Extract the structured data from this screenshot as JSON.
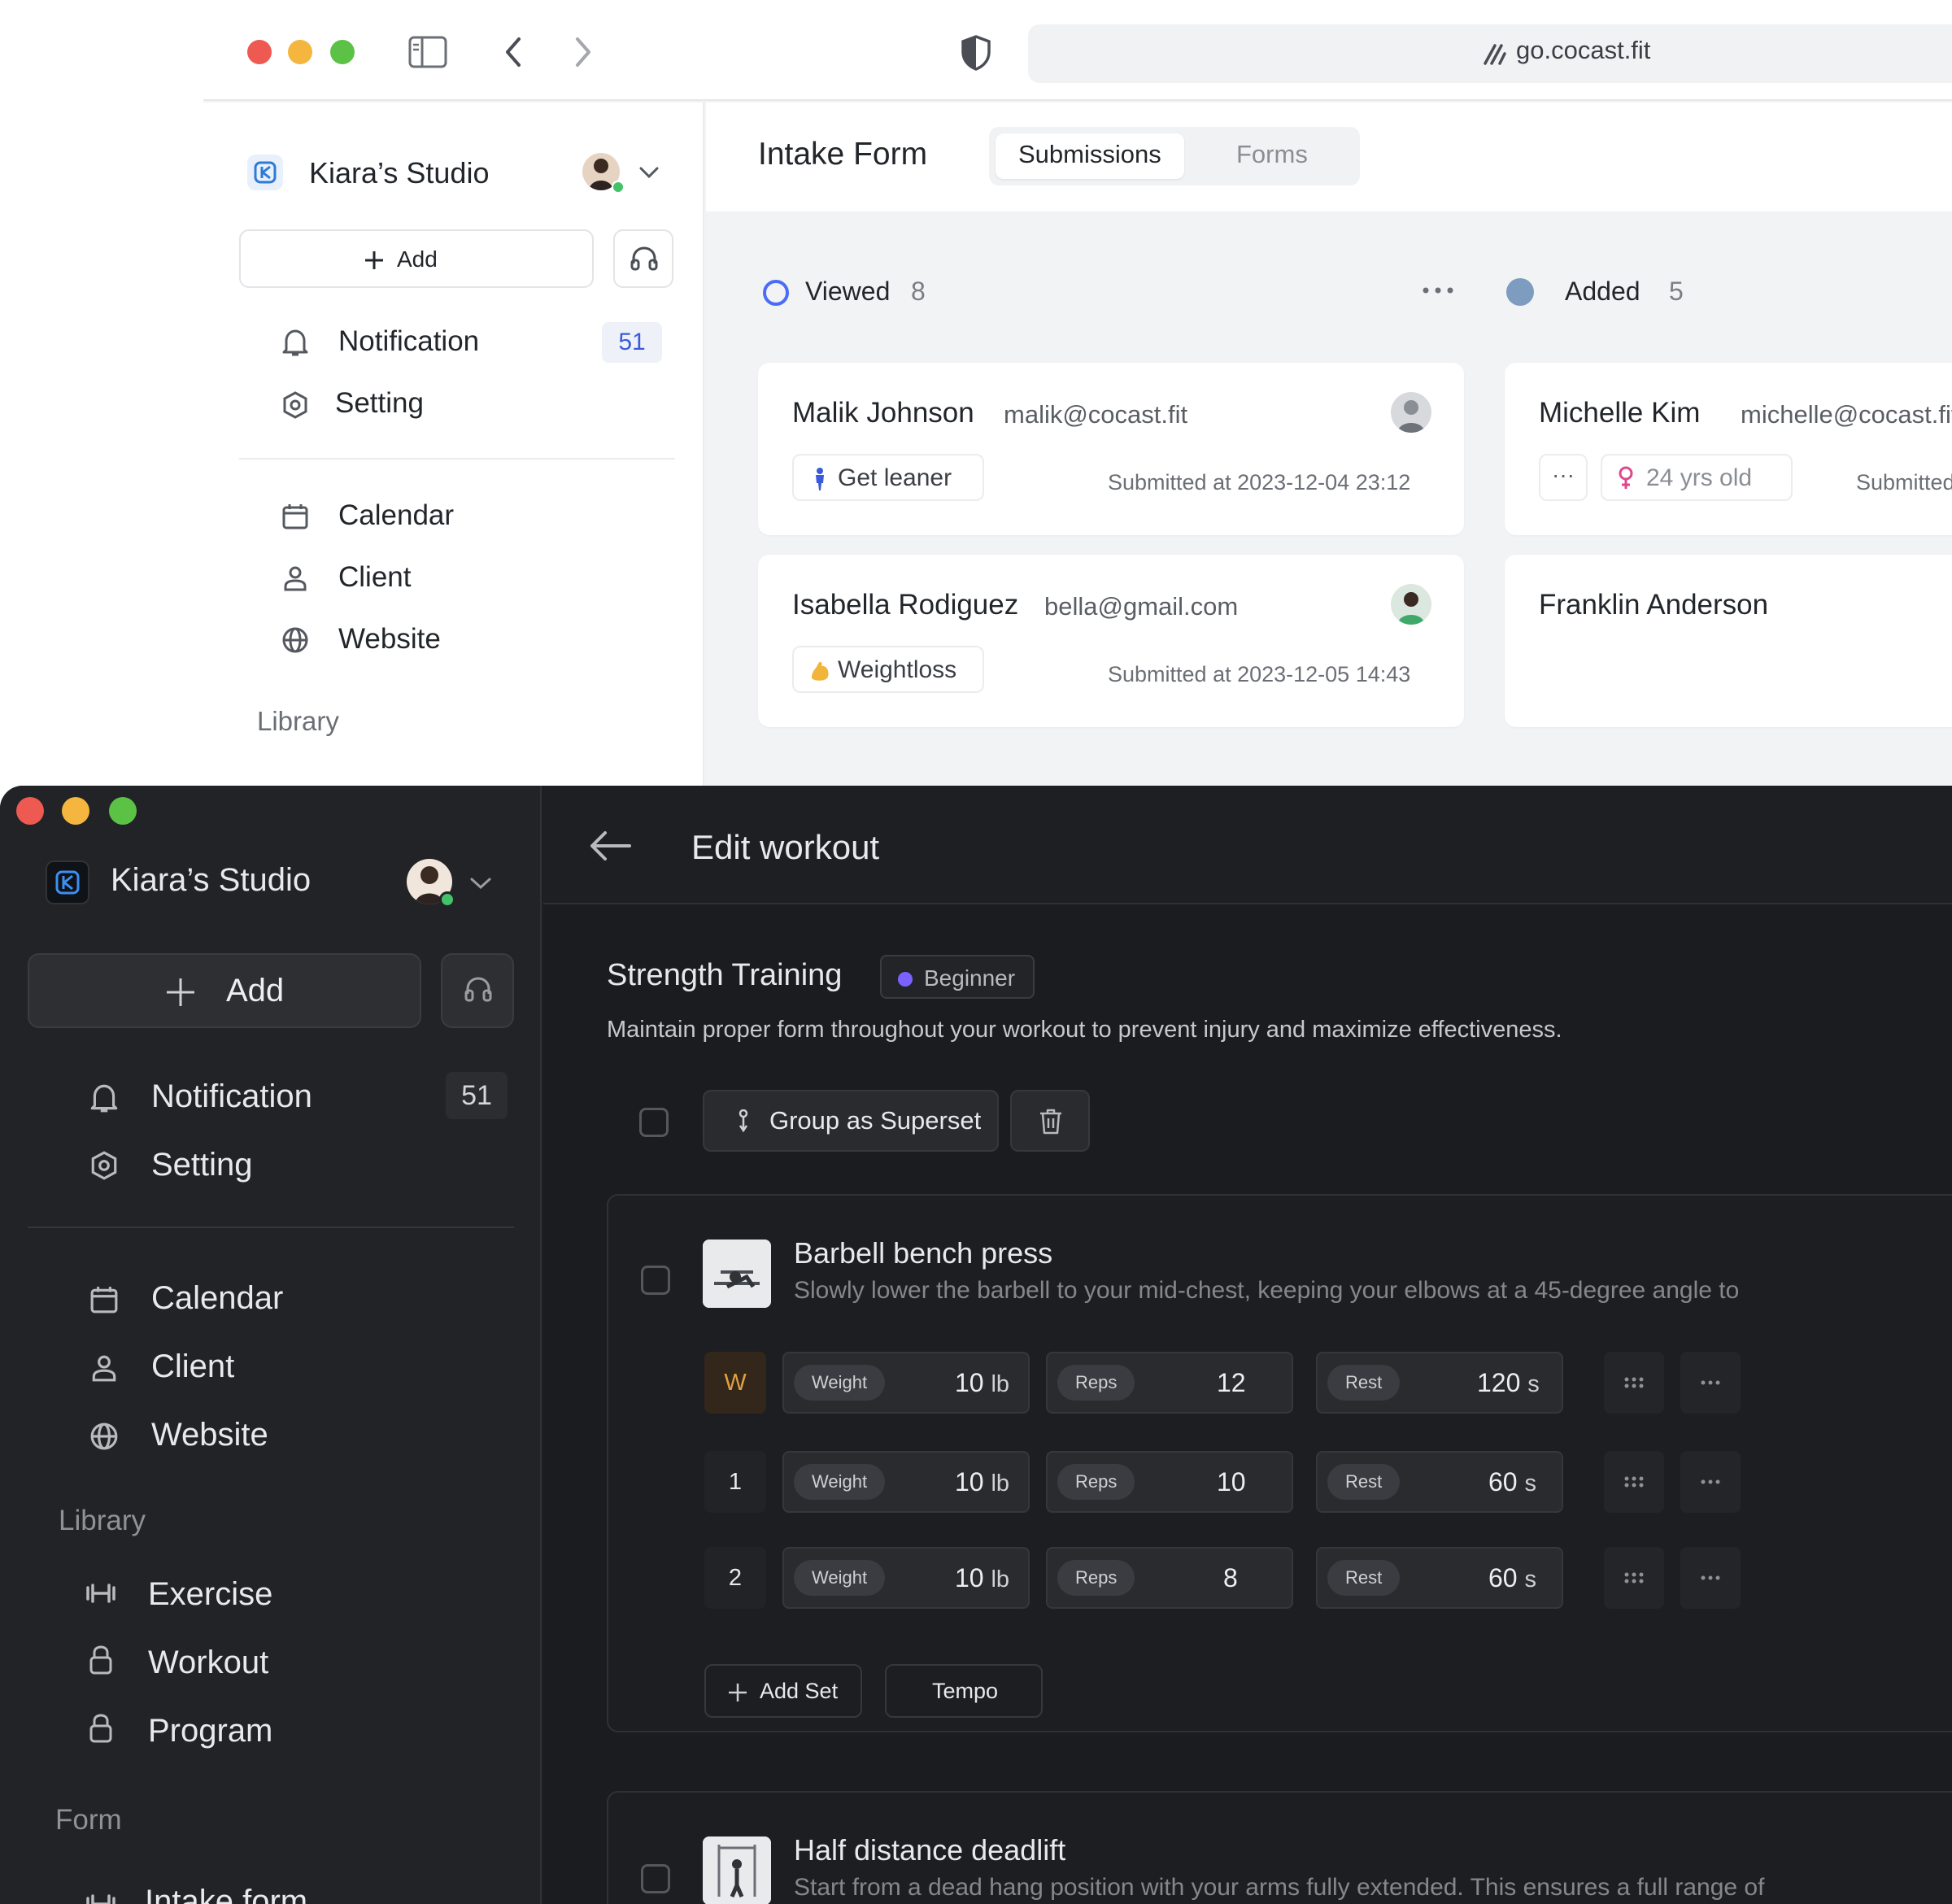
{
  "browser": {
    "url": "go.cocast.fit"
  },
  "light_app": {
    "studio_name": "Kiara’s Studio",
    "add_label": "Add",
    "nav": {
      "notification": "Notification",
      "notification_count": "51",
      "setting": "Setting",
      "calendar": "Calendar",
      "client": "Client",
      "website": "Website",
      "library": "Library"
    },
    "page_title": "Intake Form",
    "tabs": [
      "Submissions",
      "Forms"
    ],
    "columns": [
      {
        "label": "Viewed",
        "count": "8"
      },
      {
        "label": "Added",
        "count": "5"
      }
    ],
    "cards": [
      {
        "name": "Malik Johnson",
        "email": "malik@cocast.fit",
        "tag": "Get leaner",
        "submitted": "Submitted at 2023-12-04 23:12"
      },
      {
        "name": "Isabella Rodiguez",
        "email": "bella@gmail.com",
        "tag": "Weightloss",
        "submitted": "Submitted at 2023-12-05 14:43"
      },
      {
        "name": "Michelle Kim",
        "email": "michelle@cocast.fit",
        "more": "···",
        "tag": "24 yrs old",
        "submitted": "Submitted at"
      },
      {
        "name": "Franklin Anderson"
      }
    ]
  },
  "dark_app": {
    "studio_name": "Kiara’s Studio",
    "add_label": "Add",
    "nav": {
      "notification": "Notification",
      "notification_count": "51",
      "setting": "Setting",
      "calendar": "Calendar",
      "client": "Client",
      "website": "Website",
      "library": "Library",
      "exercise": "Exercise",
      "workout": "Workout",
      "program": "Program",
      "form": "Form",
      "intake_form": "Intake form"
    },
    "page_title": "Edit workout",
    "workout": {
      "name": "Strength Training",
      "level": "Beginner",
      "description": "Maintain proper form throughout your workout to prevent injury and maximize effectiveness.",
      "group_superset": "Group as Superset"
    },
    "exercises": [
      {
        "name": "Barbell bench press",
        "description": "Slowly lower the barbell to your mid-chest, keeping your elbows at a 45-degree angle to",
        "sets": [
          {
            "label": "W",
            "weight": "10",
            "weight_unit": "lb",
            "reps": "12",
            "rest": "120",
            "rest_unit": "s"
          },
          {
            "label": "1",
            "weight": "10",
            "weight_unit": "lb",
            "reps": "10",
            "rest": "60",
            "rest_unit": "s"
          },
          {
            "label": "2",
            "weight": "10",
            "weight_unit": "lb",
            "reps": "8",
            "rest": "60",
            "rest_unit": "s"
          }
        ],
        "add_set": "Add Set",
        "tempo": "Tempo"
      },
      {
        "name": "Half distance deadlift",
        "description": "Start from a dead hang position with your arms fully extended. This ensures a full range of"
      }
    ],
    "set_labels": {
      "weight": "Weight",
      "reps": "Reps",
      "rest": "Rest"
    }
  },
  "colors": {
    "viewed_ring": "#4a6cf7",
    "added_dot": "#7d9cc0",
    "beginner_dot": "#7b61ff",
    "warmup_text": "#e0a040",
    "traffic_red": "#ee5a52",
    "traffic_yellow": "#f4b63f",
    "traffic_green": "#5cc246"
  },
  "icons": [
    "sidebar-icon",
    "back-icon",
    "forward-icon",
    "shield-icon",
    "link-icon",
    "chevron-down-icon",
    "plus-icon",
    "headset-icon",
    "bell-icon",
    "gear-icon",
    "calendar-icon",
    "user-icon",
    "globe-icon",
    "dumbbell-icon",
    "lock-icon",
    "arrow-left-icon",
    "trash-icon",
    "superset-icon",
    "drag-icon",
    "more-icon",
    "person-icon",
    "muscle-icon",
    "female-icon"
  ]
}
